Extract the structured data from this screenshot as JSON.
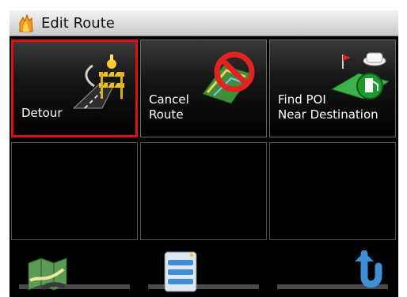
{
  "window": {
    "title": "Edit Route",
    "app_icon": "app-flame-icon"
  },
  "tiles": [
    {
      "label": "Detour",
      "icon": "detour-roadblock-icon",
      "selected": true
    },
    {
      "label": "Cancel\nRoute",
      "icon": "cancel-route-icon",
      "selected": false
    },
    {
      "label": "Find POI\nNear Destination",
      "icon": "find-poi-icon",
      "selected": false
    },
    {
      "label": "",
      "icon": "",
      "selected": false
    },
    {
      "label": "",
      "icon": "",
      "selected": false
    },
    {
      "label": "",
      "icon": "",
      "selected": false
    }
  ],
  "bottom_bar": {
    "left": "map-icon",
    "center": "list-menu-icon",
    "right": "back-arrow-icon"
  },
  "colors": {
    "selection": "#e01010",
    "background": "#000000",
    "titlebar": "#dcdcdc"
  }
}
